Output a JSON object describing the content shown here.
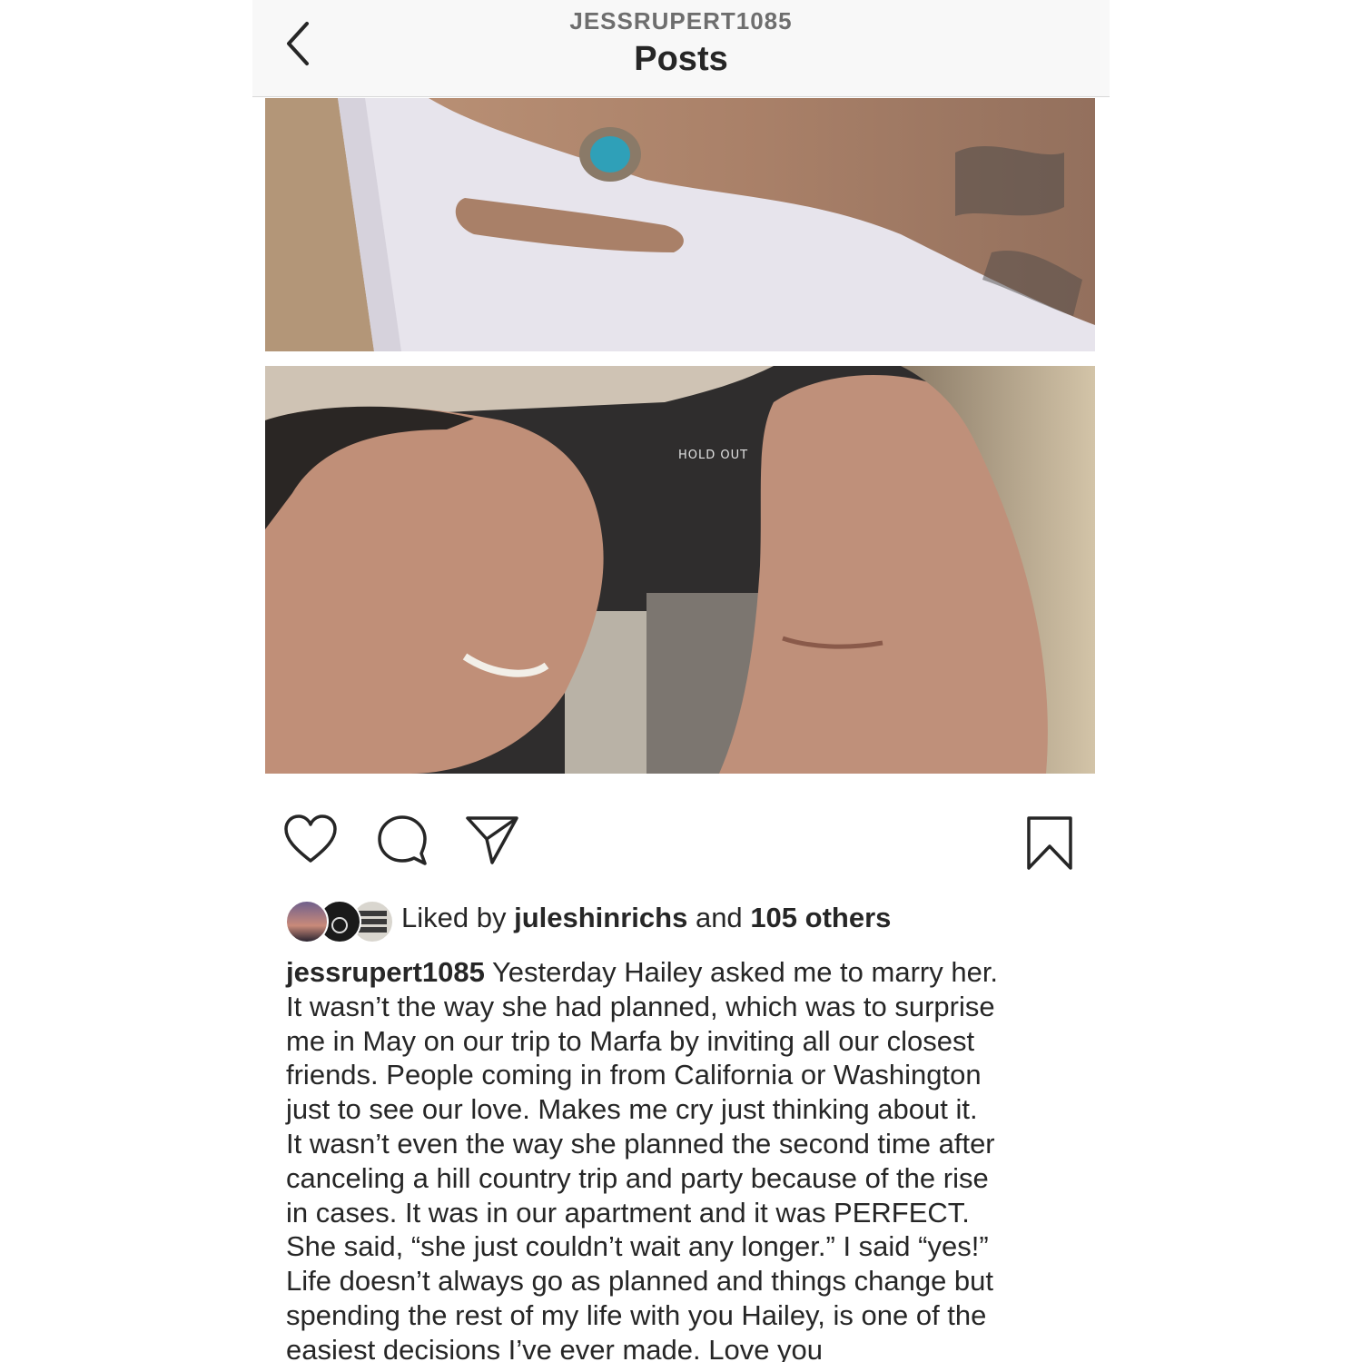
{
  "header": {
    "username": "JESSRUPERT1085",
    "title": "Posts"
  },
  "photos": {
    "top_sign_text": "HOLD OUT"
  },
  "likes": {
    "prefix": "Liked by",
    "user": "juleshinrichs",
    "joiner": "and",
    "others": "105 others"
  },
  "caption": {
    "username": "jessrupert1085",
    "lines": [
      "Yesterday Hailey asked me to marry her.",
      "It wasn’t the way she had planned, which was to surprise",
      "me in May on our trip to Marfa by inviting all our closest",
      "friends. People coming in from California or Washington",
      "just to see our love. Makes me cry just thinking about it.",
      "It wasn’t even the way she planned the second time after",
      "canceling a hill country trip and party because of the rise",
      "in cases. It was in our apartment and it was PERFECT.",
      "She said, “she just couldn’t wait any longer.” I said “yes!”",
      "Life doesn’t always go as planned and things change but",
      "spending the rest of my life with you Hailey, is one of the",
      "easiest decisions I’ve ever made. Love you"
    ]
  },
  "icons": {
    "back": "chevron-left-icon",
    "like": "heart-icon",
    "comment": "comment-bubble-icon",
    "share": "paper-plane-icon",
    "save": "bookmark-icon"
  }
}
